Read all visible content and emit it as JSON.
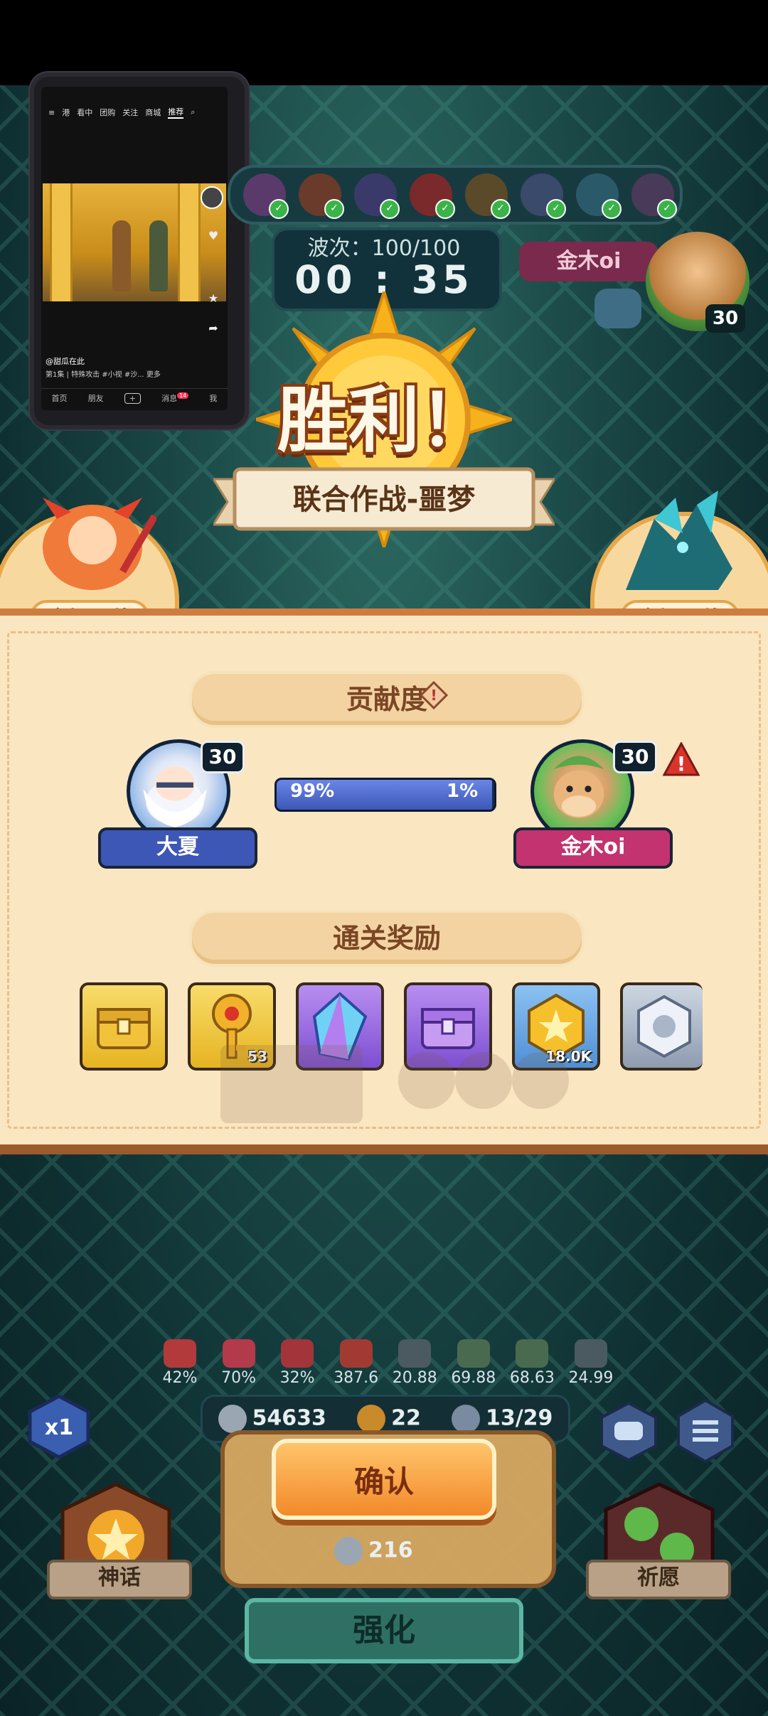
{
  "video_pip": {
    "nav_tabs": [
      "≡",
      "港",
      "看中",
      "团购",
      "关注",
      "商城",
      "推荐"
    ],
    "caption": "@甜瓜在此",
    "subtitle": "第1集 | 特殊攻击 #小视 #沙... 更多",
    "bottom_tabs": [
      "首页",
      "朋友",
      "+",
      "消息",
      "我"
    ],
    "message_badge": "14"
  },
  "hud": {
    "wave_label": "波次：100/100",
    "timer": "00 : 35",
    "partner_name": "金木oi",
    "partner_level": "30"
  },
  "victory": {
    "title": "胜利！",
    "mode": "联合作战-噩梦",
    "mvp_left": "全场最佳",
    "mvp_right": "全场最佳"
  },
  "contribution": {
    "heading": "贡献度",
    "player1": {
      "name": "大夏",
      "level": "30",
      "percent_label": "99%",
      "share": 0.99
    },
    "player2": {
      "name": "金木oi",
      "level": "30",
      "percent_label": "1%"
    }
  },
  "rewards": {
    "heading": "通关奖励",
    "items": [
      {
        "icon": "gold-chest-icon",
        "qty": ""
      },
      {
        "icon": "gold-key-icon",
        "qty": "53"
      },
      {
        "icon": "crystal-icon",
        "qty": ""
      },
      {
        "icon": "purple-chest-icon",
        "qty": ""
      },
      {
        "icon": "star-coin-icon",
        "qty": "18.0K"
      },
      {
        "icon": "silver-emblem-icon",
        "qty": ""
      }
    ]
  },
  "stats": [
    "42%",
    "70%",
    "32%",
    "387.6",
    "20.88",
    "69.88",
    "68.63",
    "24.99"
  ],
  "resources": {
    "silver": "54633",
    "clover": "22",
    "units": "13/29"
  },
  "speed": "x1",
  "confirm_label": "确认",
  "confirm_cost": "216",
  "myth_label": "神话",
  "wish_label": "祈愿",
  "enhance_label": "强化"
}
